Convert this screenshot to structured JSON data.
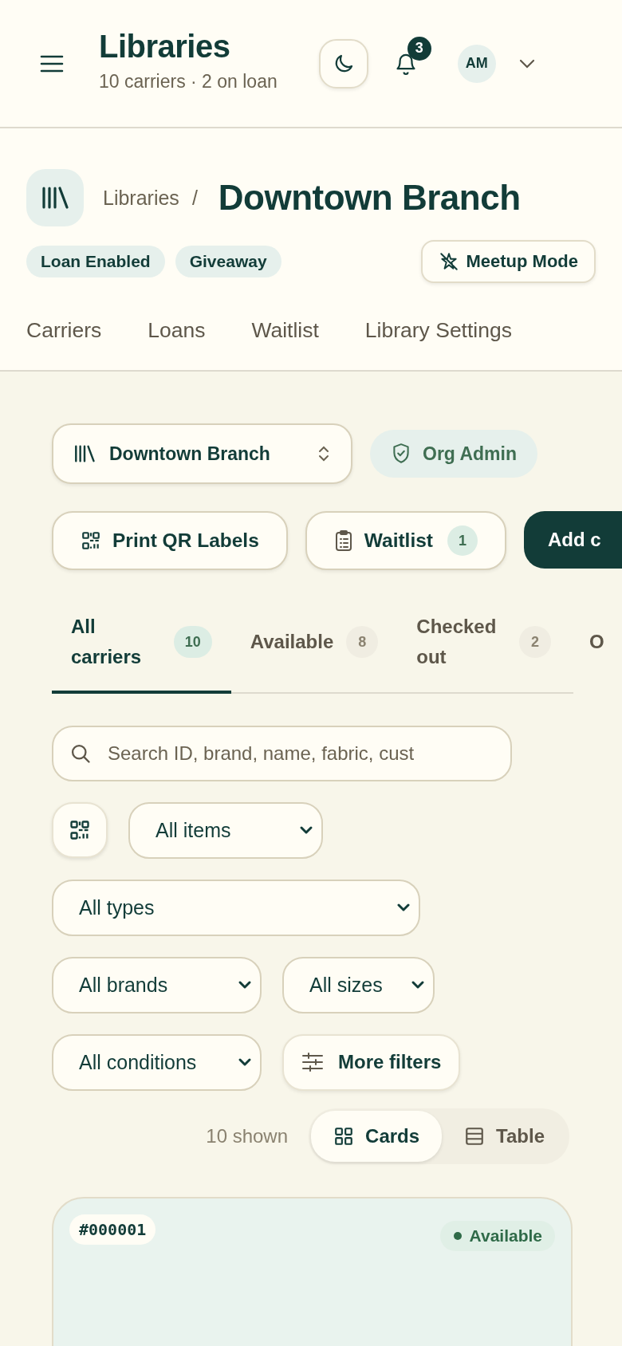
{
  "app_bar": {
    "title": "Libraries",
    "subtitle": "10 carriers · 2 on loan",
    "notification_count": "3",
    "avatar_initials": "AM"
  },
  "library": {
    "breadcrumb": "Libraries",
    "separator": "/",
    "name": "Downtown Branch",
    "badges": [
      "Loan Enabled",
      "Giveaway"
    ],
    "meetup_button": "Meetup Mode"
  },
  "nav_tabs": [
    "Carriers",
    "Loans",
    "Waitlist",
    "Library Settings"
  ],
  "branch_select": "Downtown Branch",
  "role_badge": "Org Admin",
  "actions": [
    {
      "kind": "print",
      "label": "Print QR Labels"
    },
    {
      "kind": "waitlist",
      "label": "Waitlist",
      "count": "1"
    },
    {
      "kind": "add",
      "label": "Add c"
    }
  ],
  "status_tabs": [
    {
      "label": "All carriers",
      "count": "10",
      "selected": true
    },
    {
      "label": "Available",
      "count": "8",
      "selected": false
    },
    {
      "label": "Checked out",
      "count": "2",
      "selected": false
    },
    {
      "label": "O",
      "selected": false
    }
  ],
  "search": {
    "placeholder": "Search ID, brand, name, fabric, cust"
  },
  "filter_rows": [
    [
      {
        "kind": "scan"
      },
      {
        "kind": "select",
        "value": "All items"
      }
    ],
    [
      {
        "kind": "select",
        "value": "All types"
      }
    ],
    [
      {
        "kind": "select",
        "value": "All brands"
      },
      {
        "kind": "select",
        "value": "All sizes"
      }
    ],
    [
      {
        "kind": "select",
        "value": "All conditions"
      },
      {
        "kind": "button",
        "label": "More filters"
      }
    ]
  ],
  "view": {
    "count_text": "10 shown",
    "modes": [
      {
        "kind": "cards",
        "label": "Cards",
        "selected": true
      },
      {
        "kind": "table",
        "label": "Table",
        "selected": false
      }
    ]
  },
  "cards": [
    {
      "id": "#000001",
      "status": "Available"
    }
  ]
}
